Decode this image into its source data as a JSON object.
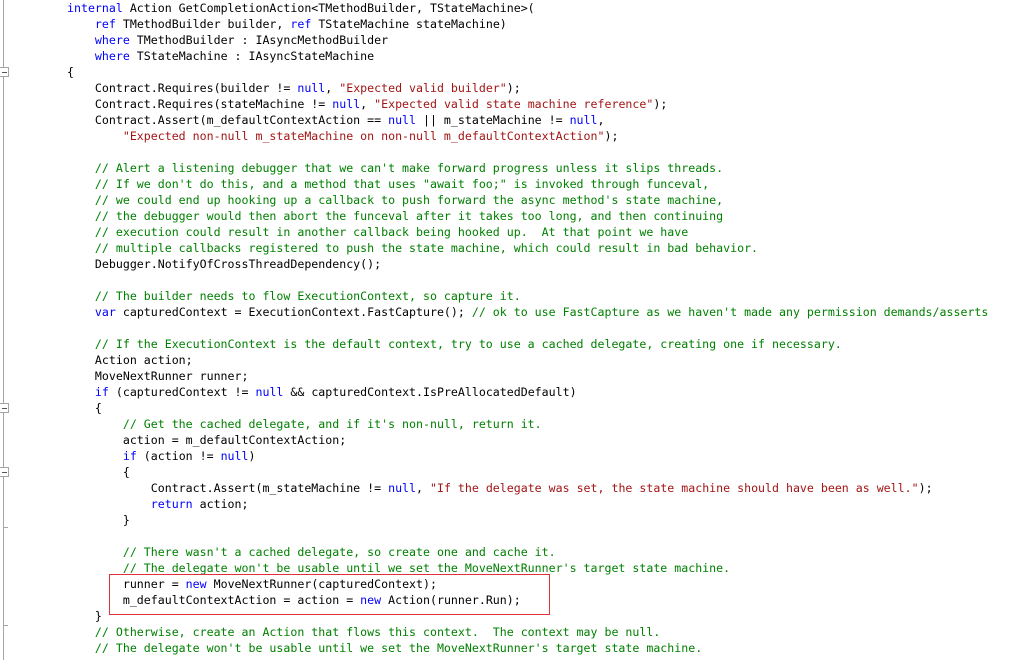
{
  "editor": {
    "colors": {
      "keyword": "#0000ff",
      "string": "#a31515",
      "comment": "#008000",
      "text": "#000000",
      "highlight_box": "#e0313b"
    },
    "fold_icons": [
      "collapse-icon",
      "collapse-icon",
      "collapse-icon"
    ],
    "lines": [
      {
        "tokens": [
          [
            "k",
            "internal"
          ],
          [
            "t",
            " Action GetCompletionAction<TMethodBuilder, TStateMachine>("
          ]
        ]
      },
      {
        "tokens": [
          [
            "t",
            "    "
          ],
          [
            "k",
            "ref"
          ],
          [
            "t",
            " TMethodBuilder builder, "
          ],
          [
            "k",
            "ref"
          ],
          [
            "t",
            " TStateMachine stateMachine)"
          ]
        ]
      },
      {
        "tokens": [
          [
            "t",
            "    "
          ],
          [
            "k",
            "where"
          ],
          [
            "t",
            " TMethodBuilder : IAsyncMethodBuilder"
          ]
        ]
      },
      {
        "tokens": [
          [
            "t",
            "    "
          ],
          [
            "k",
            "where"
          ],
          [
            "t",
            " TStateMachine : IAsyncStateMachine"
          ]
        ]
      },
      {
        "tokens": [
          [
            "t",
            "{"
          ]
        ]
      },
      {
        "tokens": [
          [
            "t",
            "    Contract.Requires(builder != "
          ],
          [
            "k",
            "null"
          ],
          [
            "t",
            ", "
          ],
          [
            "s",
            "\"Expected valid builder\""
          ],
          [
            "t",
            ");"
          ]
        ]
      },
      {
        "tokens": [
          [
            "t",
            "    Contract.Requires(stateMachine != "
          ],
          [
            "k",
            "null"
          ],
          [
            "t",
            ", "
          ],
          [
            "s",
            "\"Expected valid state machine reference\""
          ],
          [
            "t",
            ");"
          ]
        ]
      },
      {
        "tokens": [
          [
            "t",
            "    Contract.Assert(m_defaultContextAction == "
          ],
          [
            "k",
            "null"
          ],
          [
            "t",
            " || m_stateMachine != "
          ],
          [
            "k",
            "null"
          ],
          [
            "t",
            ","
          ]
        ]
      },
      {
        "tokens": [
          [
            "t",
            "        "
          ],
          [
            "s",
            "\"Expected non-null m_stateMachine on non-null m_defaultContextAction\""
          ],
          [
            "t",
            ");"
          ]
        ]
      },
      {
        "tokens": []
      },
      {
        "tokens": [
          [
            "t",
            "    "
          ],
          [
            "c",
            "// Alert a listening debugger that we can't make forward progress unless it slips threads."
          ]
        ]
      },
      {
        "tokens": [
          [
            "t",
            "    "
          ],
          [
            "c",
            "// If we don't do this, and a method that uses \"await foo;\" is invoked through funceval,"
          ]
        ]
      },
      {
        "tokens": [
          [
            "t",
            "    "
          ],
          [
            "c",
            "// we could end up hooking up a callback to push forward the async method's state machine,"
          ]
        ]
      },
      {
        "tokens": [
          [
            "t",
            "    "
          ],
          [
            "c",
            "// the debugger would then abort the funceval after it takes too long, and then continuing"
          ]
        ]
      },
      {
        "tokens": [
          [
            "t",
            "    "
          ],
          [
            "c",
            "// execution could result in another callback being hooked up.  At that point we have"
          ]
        ]
      },
      {
        "tokens": [
          [
            "t",
            "    "
          ],
          [
            "c",
            "// multiple callbacks registered to push the state machine, which could result in bad behavior."
          ]
        ]
      },
      {
        "tokens": [
          [
            "t",
            "    Debugger.NotifyOfCrossThreadDependency();"
          ]
        ]
      },
      {
        "tokens": []
      },
      {
        "tokens": [
          [
            "t",
            "    "
          ],
          [
            "c",
            "// The builder needs to flow ExecutionContext, so capture it."
          ]
        ]
      },
      {
        "tokens": [
          [
            "t",
            "    "
          ],
          [
            "k",
            "var"
          ],
          [
            "t",
            " capturedContext = ExecutionContext.FastCapture(); "
          ],
          [
            "c",
            "// ok to use FastCapture as we haven't made any permission demands/asserts"
          ]
        ]
      },
      {
        "tokens": []
      },
      {
        "tokens": [
          [
            "t",
            "    "
          ],
          [
            "c",
            "// If the ExecutionContext is the default context, try to use a cached delegate, creating one if necessary."
          ]
        ]
      },
      {
        "tokens": [
          [
            "t",
            "    Action action;"
          ]
        ]
      },
      {
        "tokens": [
          [
            "t",
            "    MoveNextRunner runner;"
          ]
        ]
      },
      {
        "tokens": [
          [
            "t",
            "    "
          ],
          [
            "k",
            "if"
          ],
          [
            "t",
            " (capturedContext != "
          ],
          [
            "k",
            "null"
          ],
          [
            "t",
            " && capturedContext.IsPreAllocatedDefault)"
          ]
        ]
      },
      {
        "tokens": [
          [
            "t",
            "    {"
          ]
        ]
      },
      {
        "tokens": [
          [
            "t",
            "        "
          ],
          [
            "c",
            "// Get the cached delegate, and if it's non-null, return it."
          ]
        ]
      },
      {
        "tokens": [
          [
            "t",
            "        action = m_defaultContextAction;"
          ]
        ]
      },
      {
        "tokens": [
          [
            "t",
            "        "
          ],
          [
            "k",
            "if"
          ],
          [
            "t",
            " (action != "
          ],
          [
            "k",
            "null"
          ],
          [
            "t",
            ")"
          ]
        ]
      },
      {
        "tokens": [
          [
            "t",
            "        {"
          ]
        ]
      },
      {
        "tokens": [
          [
            "t",
            "            Contract.Assert(m_stateMachine != "
          ],
          [
            "k",
            "null"
          ],
          [
            "t",
            ", "
          ],
          [
            "s",
            "\"If the delegate was set, the state machine should have been as well.\""
          ],
          [
            "t",
            ");"
          ]
        ]
      },
      {
        "tokens": [
          [
            "t",
            "            "
          ],
          [
            "k",
            "return"
          ],
          [
            "t",
            " action;"
          ]
        ]
      },
      {
        "tokens": [
          [
            "t",
            "        }"
          ]
        ]
      },
      {
        "tokens": []
      },
      {
        "tokens": [
          [
            "t",
            "        "
          ],
          [
            "c",
            "// There wasn't a cached delegate, so create one and cache it."
          ]
        ]
      },
      {
        "tokens": [
          [
            "t",
            "        "
          ],
          [
            "c",
            "// The delegate won't be usable until we set the MoveNextRunner's target state machine."
          ]
        ]
      },
      {
        "tokens": [
          [
            "t",
            "        runner = "
          ],
          [
            "k",
            "new"
          ],
          [
            "t",
            " MoveNextRunner(capturedContext);"
          ]
        ]
      },
      {
        "tokens": [
          [
            "t",
            "        m_defaultContextAction = action = "
          ],
          [
            "k",
            "new"
          ],
          [
            "t",
            " Action(runner.Run);"
          ]
        ]
      },
      {
        "tokens": [
          [
            "t",
            "    }"
          ]
        ]
      },
      {
        "tokens": [
          [
            "t",
            "    "
          ],
          [
            "c",
            "// Otherwise, create an Action that flows this context.  The context may be null."
          ]
        ]
      },
      {
        "tokens": [
          [
            "t",
            "    "
          ],
          [
            "c",
            "// The delegate won't be usable until we set the MoveNextRunner's target state machine."
          ]
        ]
      }
    ]
  }
}
